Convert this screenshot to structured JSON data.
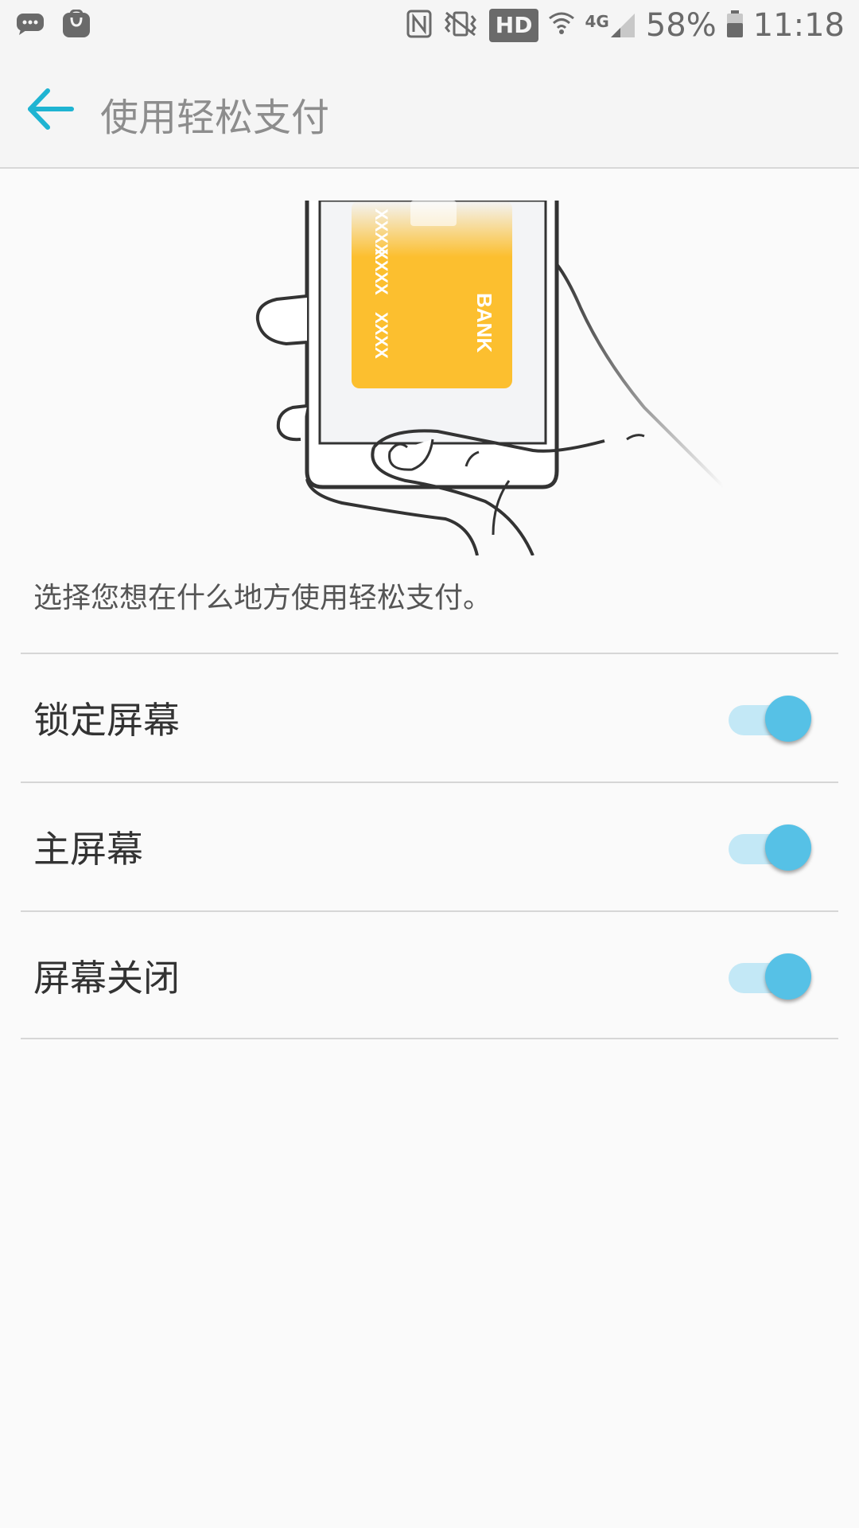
{
  "status_bar": {
    "icons_left": [
      "messages-icon",
      "galaxy-store-icon"
    ],
    "icons_right": [
      "nfc-icon",
      "vibrate-icon",
      "hd-icon",
      "wifi-icon",
      "signal-4g-icon",
      "battery-icon"
    ],
    "hd_label": "HD",
    "network_label": "4G",
    "battery": "58%",
    "time": "11:18"
  },
  "app_bar": {
    "title": "使用轻松支付",
    "back_icon": "back-arrow-icon",
    "accent_color": "#1fb4d2"
  },
  "illustration": {
    "card_text_bank": "BANK",
    "card_number_groups": [
      "XXXX",
      "XXXX",
      "XXXX"
    ],
    "card_color": "#fcbf2f"
  },
  "description": "选择您想在什么地方使用轻松支付。",
  "settings": [
    {
      "label": "锁定屏幕",
      "enabled": true
    },
    {
      "label": "主屏幕",
      "enabled": true
    },
    {
      "label": "屏幕关闭",
      "enabled": true
    }
  ],
  "toggle_colors": {
    "track": "#c3e8f6",
    "knob": "#56c1e6"
  }
}
